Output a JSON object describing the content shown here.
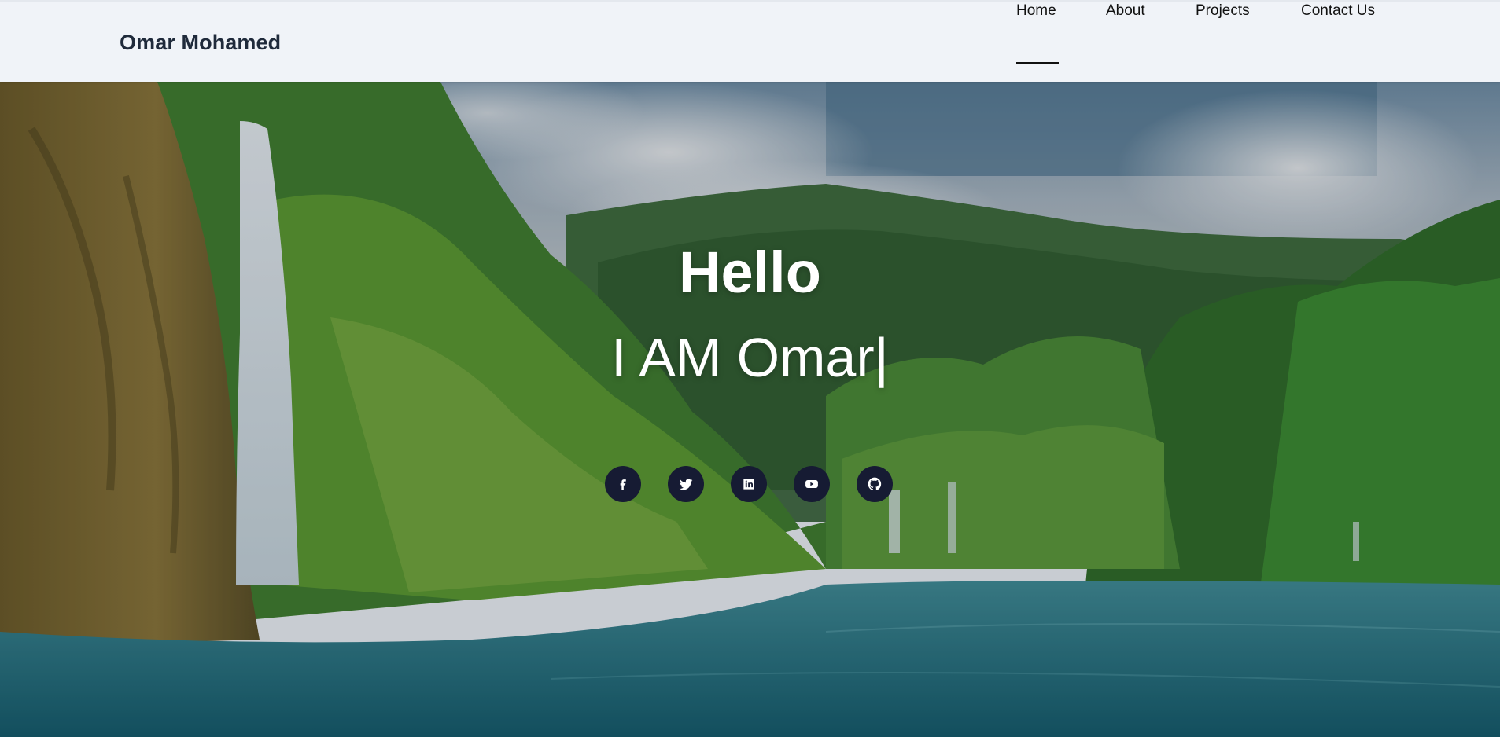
{
  "brand": {
    "name": "Omar Mohamed"
  },
  "nav": {
    "items": [
      {
        "label": "Home",
        "active": true
      },
      {
        "label": "About",
        "active": false
      },
      {
        "label": "Projects",
        "active": false
      },
      {
        "label": "Contact Us",
        "active": false
      }
    ]
  },
  "hero": {
    "title": "Hello",
    "subtitle": "I AM Omar|"
  },
  "socials": [
    {
      "icon": "facebook-icon"
    },
    {
      "icon": "twitter-icon"
    },
    {
      "icon": "linkedin-icon"
    },
    {
      "icon": "youtube-icon"
    },
    {
      "icon": "github-icon"
    }
  ],
  "colors": {
    "navbar_bg": "#f0f3f8",
    "brand_text": "#1f2a3b",
    "social_bg": "#161b33",
    "hero_text": "#ffffff"
  }
}
